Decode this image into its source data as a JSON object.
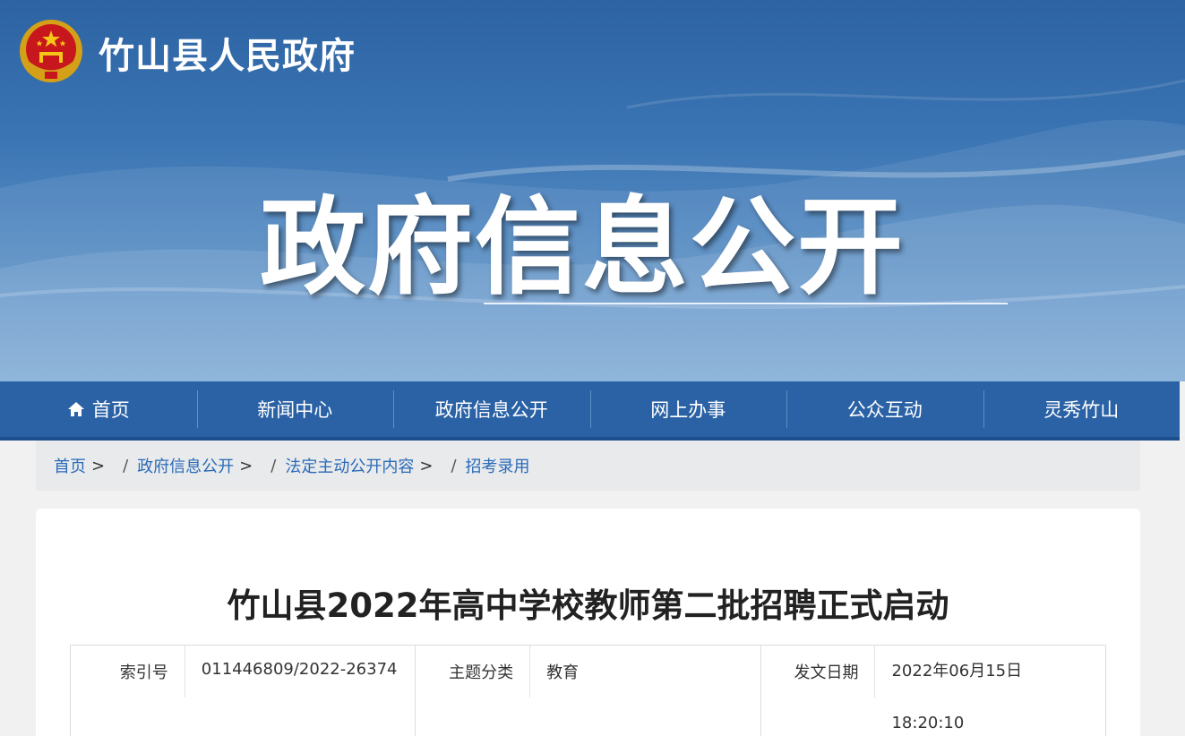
{
  "header": {
    "site_name": "竹山县人民政府",
    "hero_title": "政府信息公开"
  },
  "nav": {
    "items": [
      "首页",
      "新闻中心",
      "政府信息公开",
      "网上办事",
      "公众互动",
      "灵秀竹山"
    ]
  },
  "breadcrumb": {
    "items": [
      "首页",
      "政府信息公开",
      "法定主动公开内容",
      "招考录用"
    ],
    "separator": ">",
    "slash": "/"
  },
  "article": {
    "title": "竹山县2022年高中学校教师第二批招聘正式启动",
    "meta": {
      "index_label": "索引号",
      "index_value": "011446809/2022-26374",
      "topic_label": "主题分类",
      "topic_value": "教育",
      "date_label": "发文日期",
      "date_value": "2022年06月15日",
      "time_value": "18:20:10"
    }
  },
  "colors": {
    "banner": "#2d63a3",
    "nav": "#2a62a5",
    "link": "#2a6ab7"
  }
}
